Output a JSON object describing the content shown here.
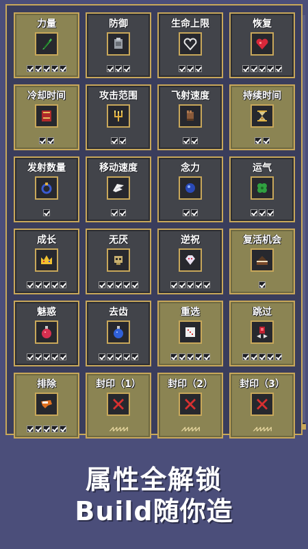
{
  "colors": {
    "frame": "#c9a85a",
    "card_lit": "#8b8453",
    "card_dark": "#42444a",
    "background": "#4b4e7a"
  },
  "cards": [
    {
      "title": "力量",
      "icon": "feather-icon",
      "marks": 5,
      "lit": true
    },
    {
      "title": "防御",
      "icon": "armor-icon",
      "marks": 3,
      "lit": false
    },
    {
      "title": "生命上限",
      "icon": "heart-outline-icon",
      "marks": 3,
      "lit": false
    },
    {
      "title": "恢复",
      "icon": "heart-icon",
      "marks": 5,
      "lit": false
    },
    {
      "title": "冷却时间",
      "icon": "book-icon",
      "marks": 2,
      "lit": true
    },
    {
      "title": "攻击范围",
      "icon": "candelabra-icon",
      "marks": 2,
      "lit": false
    },
    {
      "title": "飞射速度",
      "icon": "gauntlet-icon",
      "marks": 2,
      "lit": false
    },
    {
      "title": "持续时间",
      "icon": "hourglass-icon",
      "marks": 2,
      "lit": true
    },
    {
      "title": "发射数量",
      "icon": "ring-icon",
      "marks": 1,
      "lit": false
    },
    {
      "title": "移动速度",
      "icon": "wing-icon",
      "marks": 2,
      "lit": false
    },
    {
      "title": "念力",
      "icon": "orb-icon",
      "marks": 2,
      "lit": false
    },
    {
      "title": "运气",
      "icon": "clover-icon",
      "marks": 3,
      "lit": false
    },
    {
      "title": "成长",
      "icon": "crown-icon",
      "marks": 5,
      "lit": false
    },
    {
      "title": "无厌",
      "icon": "skull-icon",
      "marks": 5,
      "lit": false
    },
    {
      "title": "逆祝",
      "icon": "gem-skull-icon",
      "marks": 5,
      "lit": false
    },
    {
      "title": "复活机会",
      "icon": "cake-icon",
      "marks": 1,
      "lit": true
    },
    {
      "title": "魅惑",
      "icon": "potion-red-icon",
      "marks": 5,
      "lit": false
    },
    {
      "title": "去齿",
      "icon": "potion-blue-icon",
      "marks": 5,
      "lit": false
    },
    {
      "title": "重选",
      "icon": "dice-icon",
      "marks": 5,
      "lit": true
    },
    {
      "title": "跳过",
      "icon": "skip-icon",
      "marks": 5,
      "lit": true
    },
    {
      "title": "排除",
      "icon": "horn-icon",
      "marks": 5,
      "lit": true
    },
    {
      "title": "封印（1）",
      "icon": "cross-icon",
      "marks": 0,
      "zig": "⩘⩘⩘⩘⩘",
      "lit": true
    },
    {
      "title": "封印（2）",
      "icon": "cross-icon",
      "marks": 0,
      "zig": "⩘⩘⩘⩘⩘",
      "lit": true
    },
    {
      "title": "封印（3）",
      "icon": "cross-icon",
      "marks": 0,
      "zig": "⩘⩘⩘⩘⩘",
      "lit": true
    }
  ],
  "tagline": {
    "line1": "属性全解锁",
    "line2": "Build随你造"
  }
}
